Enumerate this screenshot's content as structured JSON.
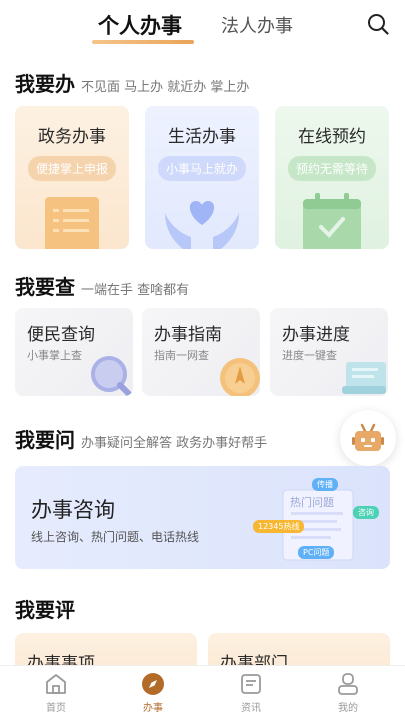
{
  "tabs": {
    "active": "个人办事",
    "inactive": "法人办事"
  },
  "sections": {
    "do": {
      "title": "我要办",
      "subtitle": "不见面 马上办 就近办 掌上办"
    },
    "query": {
      "title": "我要查",
      "subtitle": "一端在手 查啥都有"
    },
    "ask": {
      "title": "我要问",
      "subtitle": "办事疑问全解答 政务办事好帮手"
    },
    "rate": {
      "title": "我要评"
    }
  },
  "do_cards": [
    {
      "title": "政务办事",
      "pill": "便捷掌上申报"
    },
    {
      "title": "生活办事",
      "pill": "小事马上就办"
    },
    {
      "title": "在线预约",
      "pill": "预约无需等待"
    }
  ],
  "query_cards": [
    {
      "title": "便民查询",
      "subtitle": "小事掌上查"
    },
    {
      "title": "办事指南",
      "subtitle": "指南一网查"
    },
    {
      "title": "办事进度",
      "subtitle": "进度一键查"
    }
  ],
  "consult": {
    "title": "办事咨询",
    "subtitle": "线上咨询、热门问题、电话热线",
    "doc_title": "热门问题",
    "labels": {
      "top": "传播",
      "right": "咨询",
      "left": "12345热线",
      "bottom": "PC问题"
    }
  },
  "rate_cards": [
    {
      "title": "办事事项"
    },
    {
      "title": "办事部门"
    }
  ],
  "nav": [
    {
      "label": "首页",
      "icon": "home-icon"
    },
    {
      "label": "办事",
      "icon": "compass-icon"
    },
    {
      "label": "资讯",
      "icon": "news-icon"
    },
    {
      "label": "我的",
      "icon": "user-icon"
    }
  ],
  "colors": {
    "accent": "#e9a458",
    "nav_active": "#b36b2a"
  }
}
